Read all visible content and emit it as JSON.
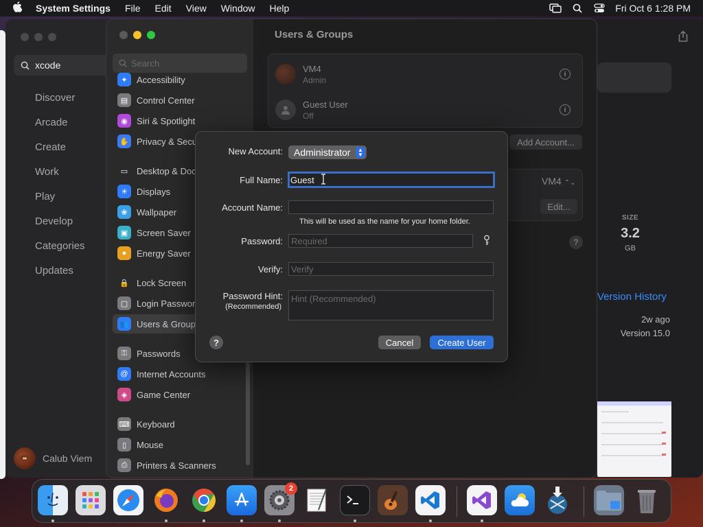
{
  "menubar": {
    "app_name": "System Settings",
    "menus": [
      "File",
      "Edit",
      "View",
      "Window",
      "Help"
    ],
    "clock": "Fri Oct 6  1:28 PM"
  },
  "appstore": {
    "search_value": "xcode",
    "nav": [
      "Discover",
      "Arcade",
      "Create",
      "Work",
      "Play",
      "Develop",
      "Categories",
      "Updates"
    ],
    "user_name": "Calub Viem",
    "size_label": "SIZE",
    "size_value": "3.2",
    "size_unit": "GB",
    "version_history": "Version History",
    "updated_ago": "2w ago",
    "version": "Version 15.0"
  },
  "settings": {
    "search_placeholder": "Search",
    "sidebar": [
      {
        "label": "Accessibility",
        "icon": "accessibility-icon",
        "color": "#2f7cf6"
      },
      {
        "label": "Control Center",
        "icon": "control-center-icon",
        "color": "#7a7a7e"
      },
      {
        "label": "Siri & Spotlight",
        "icon": "siri-icon",
        "color": "#b04ad8"
      },
      {
        "label": "Privacy & Security",
        "icon": "hand-icon",
        "color": "#3a7cf0"
      },
      {
        "label": "Desktop & Dock",
        "icon": "dock-icon",
        "color": "#2a2a2c"
      },
      {
        "label": "Displays",
        "icon": "sun-icon",
        "color": "#2f7cf6"
      },
      {
        "label": "Wallpaper",
        "icon": "wallpaper-icon",
        "color": "#3aa0e8"
      },
      {
        "label": "Screen Saver",
        "icon": "screensaver-icon",
        "color": "#3ab0c8"
      },
      {
        "label": "Energy Saver",
        "icon": "bulb-icon",
        "color": "#e8a020"
      },
      {
        "label": "Lock Screen",
        "icon": "lock-icon",
        "color": "#2a2a2c"
      },
      {
        "label": "Login Password",
        "icon": "login-lock-icon",
        "color": "#7a7a7e"
      },
      {
        "label": "Users & Groups",
        "icon": "users-icon",
        "color": "#2f7cf6"
      },
      {
        "label": "Passwords",
        "icon": "key-icon",
        "color": "#7a7a7e"
      },
      {
        "label": "Internet Accounts",
        "icon": "at-icon",
        "color": "#2f7cf6"
      },
      {
        "label": "Game Center",
        "icon": "game-center-icon",
        "color": "#d04a8a"
      },
      {
        "label": "Keyboard",
        "icon": "keyboard-icon",
        "color": "#7a7a7e"
      },
      {
        "label": "Mouse",
        "icon": "mouse-icon",
        "color": "#7a7a7e"
      },
      {
        "label": "Printers & Scanners",
        "icon": "printer-icon",
        "color": "#7a7a7e"
      }
    ],
    "pane_title": "Users & Groups",
    "users": [
      {
        "name": "VM4",
        "role": "Admin"
      },
      {
        "name": "Guest User",
        "role": "Off"
      }
    ],
    "add_account": "Add Account...",
    "autologin_value": "VM4",
    "edit_label": "Edit..."
  },
  "dialog": {
    "new_account_label": "New Account:",
    "new_account_value": "Administrator",
    "full_name_label": "Full Name:",
    "full_name_value": "Guest",
    "account_name_label": "Account Name:",
    "account_name_value": "",
    "account_name_note": "This will be used as the name for your home folder.",
    "password_label": "Password:",
    "password_placeholder": "Required",
    "verify_label": "Verify:",
    "verify_placeholder": "Verify",
    "hint_label": "Password Hint:",
    "hint_sublabel": "(Recommended)",
    "hint_placeholder": "Hint (Recommended)",
    "cancel": "Cancel",
    "create": "Create User"
  },
  "dock": {
    "settings_badge": "2"
  },
  "colors": {
    "accent": "#2c6fd6",
    "badge": "#e8412f",
    "link": "#3a8cff"
  }
}
